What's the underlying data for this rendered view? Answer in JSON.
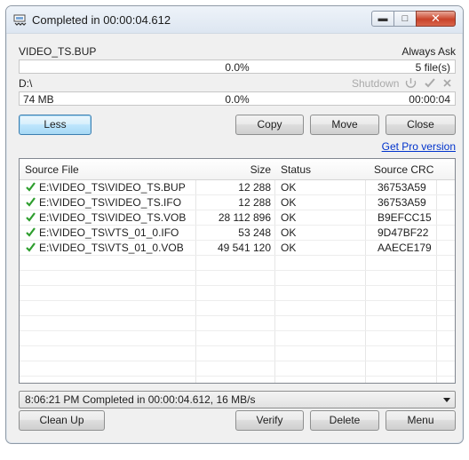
{
  "window": {
    "title": "Completed in 00:00:04.612"
  },
  "source": {
    "name": "VIDEO_TS.BUP",
    "mode": "Always Ask",
    "progress_text": "0.0%",
    "progress": 0,
    "files": "5 file(s)"
  },
  "dest": {
    "name": "D:\\",
    "shutdown": "Shutdown",
    "size": "74 MB",
    "progress_text": "0.0%",
    "progress": 0,
    "time": "00:00:04"
  },
  "buttons": {
    "less": "Less",
    "copy": "Copy",
    "move": "Move",
    "close": "Close",
    "cleanup": "Clean Up",
    "verify": "Verify",
    "delete": "Delete",
    "menu": "Menu"
  },
  "pro_link": "Get Pro version",
  "table": {
    "columns": [
      "Source File",
      "Size",
      "Status",
      "Source CRC"
    ],
    "rows": [
      {
        "file": "E:\\VIDEO_TS\\VIDEO_TS.BUP",
        "size": "12 288",
        "status": "OK",
        "crc": "36753A59"
      },
      {
        "file": "E:\\VIDEO_TS\\VIDEO_TS.IFO",
        "size": "12 288",
        "status": "OK",
        "crc": "36753A59"
      },
      {
        "file": "E:\\VIDEO_TS\\VIDEO_TS.VOB",
        "size": "28 112 896",
        "status": "OK",
        "crc": "B9EFCC15"
      },
      {
        "file": "E:\\VIDEO_TS\\VTS_01_0.IFO",
        "size": "53 248",
        "status": "OK",
        "crc": "9D47BF22"
      },
      {
        "file": "E:\\VIDEO_TS\\VTS_01_0.VOB",
        "size": "49 541 120",
        "status": "OK",
        "crc": "AAECE179"
      }
    ]
  },
  "log": {
    "selected": "8:06:21 PM Completed in 00:00:04.612, 16 MB/s"
  },
  "colors": {
    "check": "#2e9e2e",
    "link": "#0033cc",
    "close_button": "#c9432a"
  },
  "icons": [
    "app-icon",
    "minimize-icon",
    "maximize-icon",
    "close-icon",
    "shutdown-icon",
    "checkmark-icon",
    "cancel-icon",
    "check-icon",
    "dropdown-arrow-icon"
  ]
}
